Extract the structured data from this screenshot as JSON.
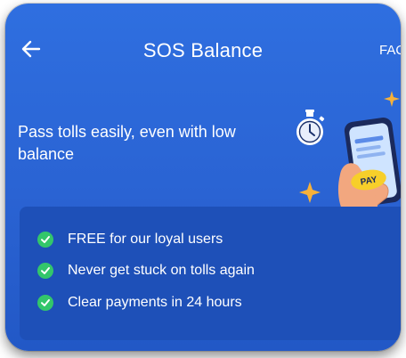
{
  "header": {
    "title": "SOS Balance",
    "faq_label": "FAQ"
  },
  "hero": {
    "text": "Pass tolls easily, even with low balance",
    "pay_label": "PAY"
  },
  "benefits": [
    {
      "text": "FREE for our loyal users"
    },
    {
      "text": "Never get stuck on tolls again"
    },
    {
      "text": "Clear payments in 24 hours"
    }
  ],
  "colors": {
    "background": "#2a63d3",
    "panel": "#1e50b8",
    "check": "#33c66a",
    "pay_button": "#f7cf2a",
    "accent_star": "#f6b13a"
  },
  "icons": {
    "back": "back-arrow-icon",
    "check": "check-circle-icon",
    "stopwatch": "stopwatch-icon",
    "sparkle": "sparkle-icon"
  }
}
